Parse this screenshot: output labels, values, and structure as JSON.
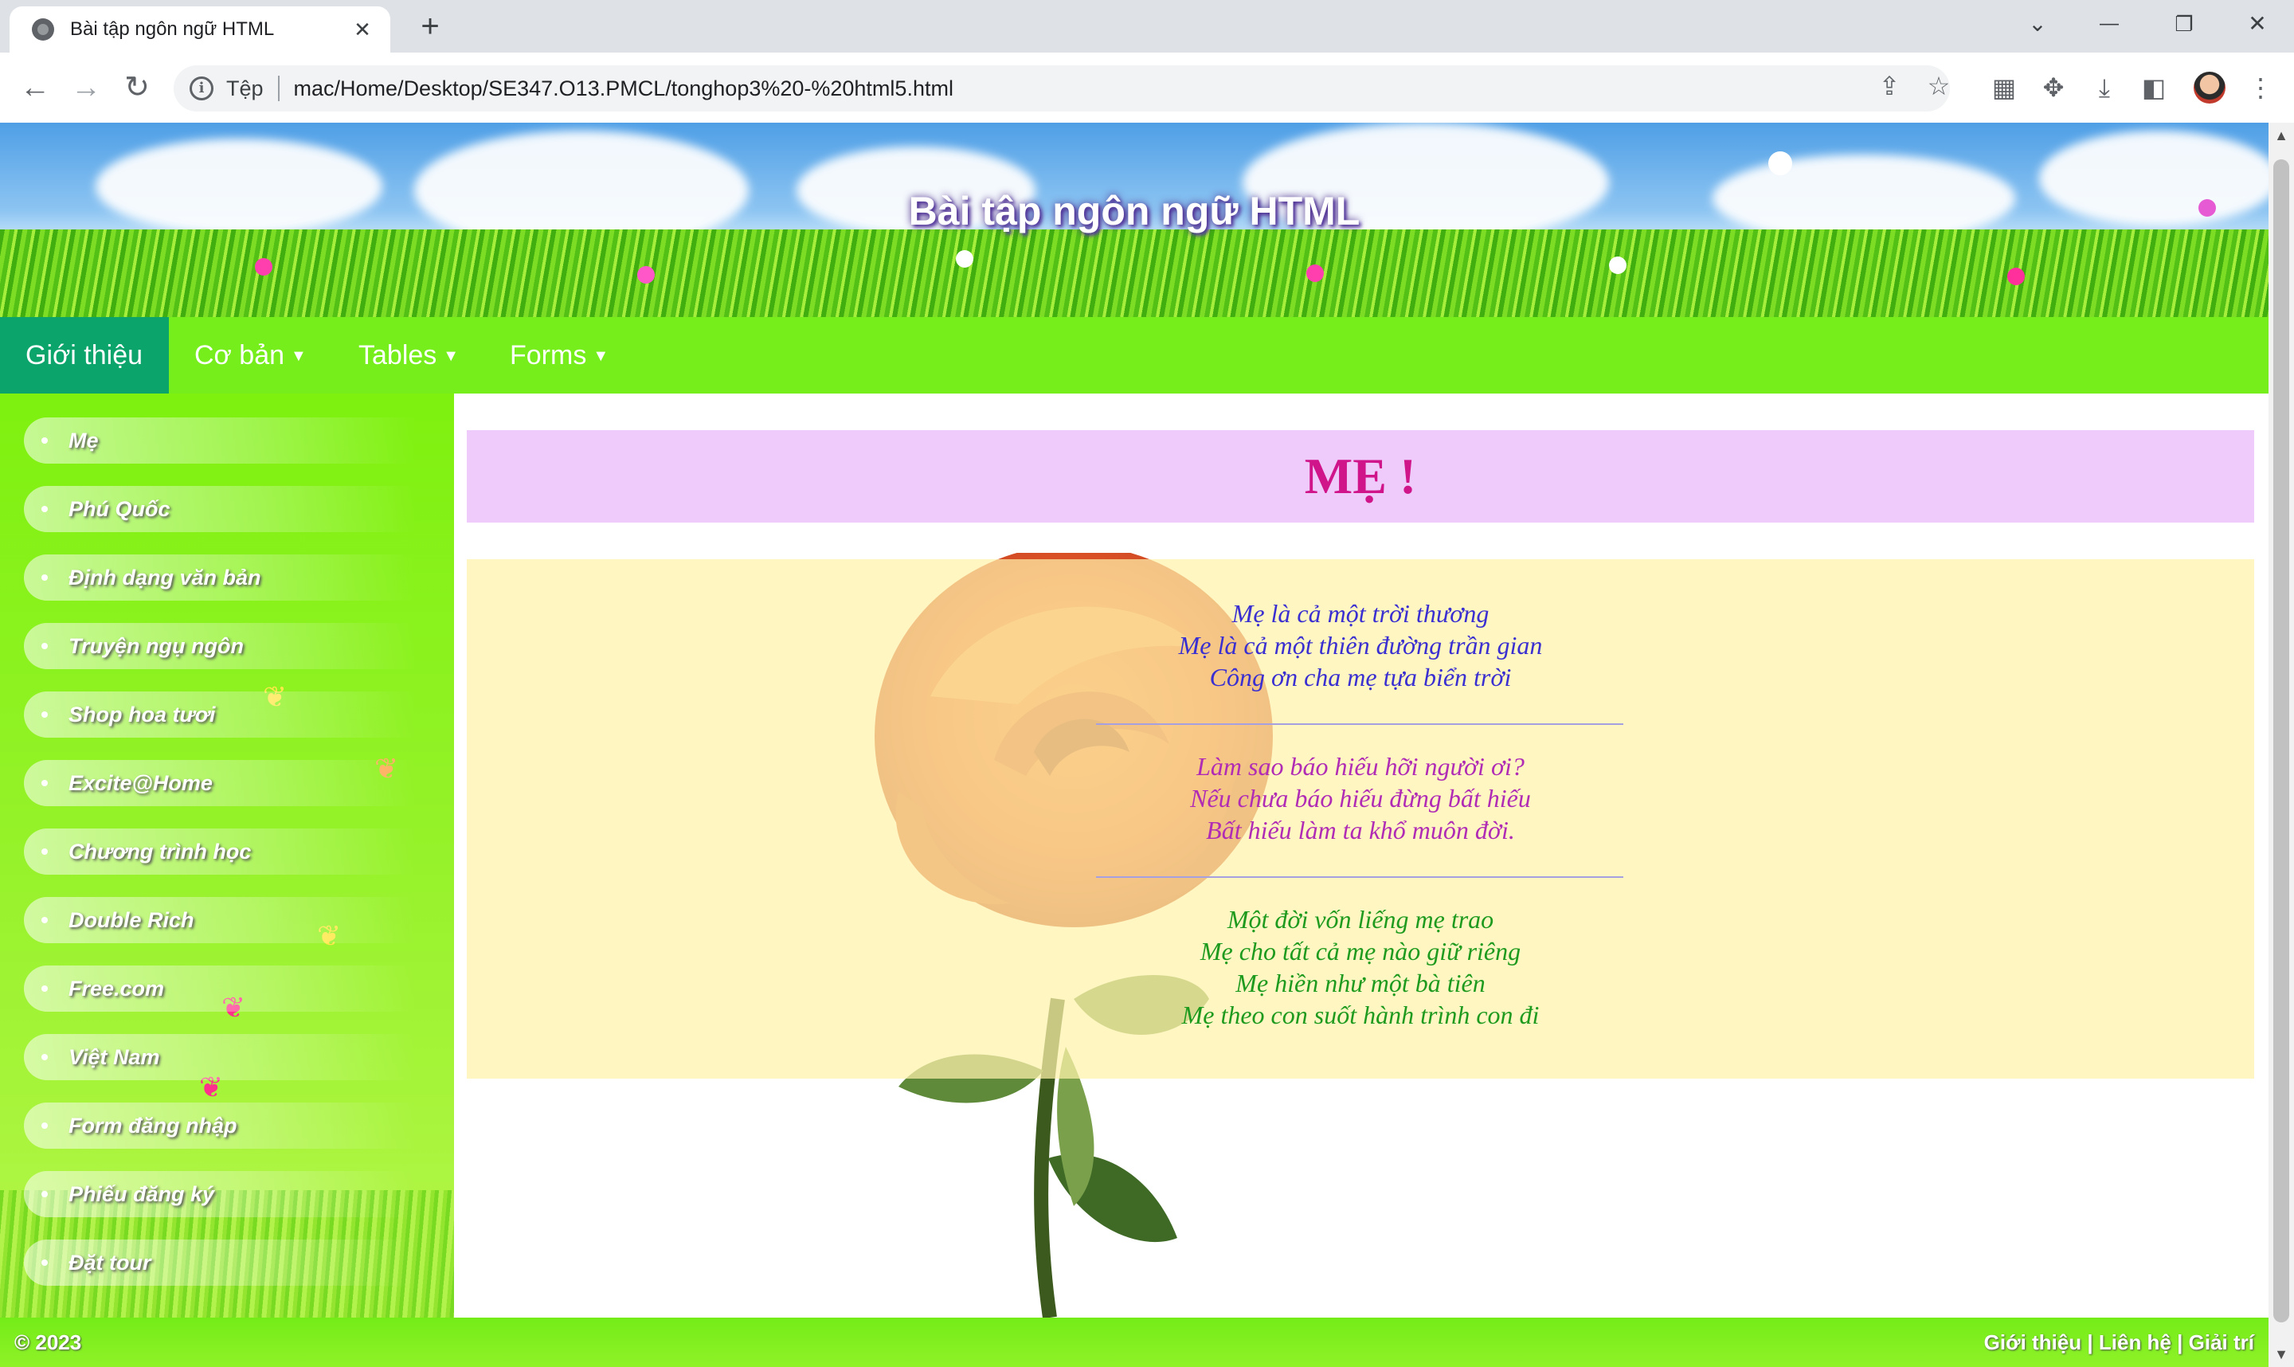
{
  "browser": {
    "tab_title": "Bài tập ngôn ngữ HTML",
    "tab_close": "✕",
    "new_tab": "+",
    "scheme_label": "Tệp",
    "url": "mac/Home/Desktop/SE347.O13.PMCL/tonghop3%20-%20html5.html",
    "window_controls": {
      "tab_search": "⌄",
      "minimize": "—",
      "restore": "❐",
      "close": "✕"
    },
    "nav": {
      "back": "←",
      "forward": "→",
      "reload": "↻"
    }
  },
  "banner": {
    "title": "Bài tập ngôn ngữ HTML"
  },
  "menu": {
    "items": [
      {
        "label": "Giới thiệu",
        "caret": ""
      },
      {
        "label": "Cơ bản",
        "caret": "▼"
      },
      {
        "label": "Tables",
        "caret": "▼"
      },
      {
        "label": "Forms",
        "caret": "▼"
      }
    ]
  },
  "sidebar": {
    "items": [
      "Mẹ",
      "Phú Quốc",
      "Định dạng văn bản",
      "Truyện ngụ ngôn",
      "Shop hoa tươi",
      "Excite@Home",
      "Chương trình học",
      "Double Rich",
      "Free.com",
      "Việt Nam",
      "Form đăng nhập",
      "Phiếu đăng ký",
      "Đặt tour"
    ]
  },
  "main": {
    "heading": "MẸ !",
    "stanzas": [
      {
        "color": "#3a2fd0",
        "lines": [
          "Mẹ là cả một trời thương",
          "Mẹ là cả một thiên đường trần gian",
          "Công ơn cha mẹ tựa biển trời"
        ]
      },
      {
        "color": "#b02cb5",
        "lines": [
          "Làm sao báo hiếu hỡi người ơi?",
          "Nếu chưa báo hiếu đừng bất hiếu",
          "Bất hiếu làm ta khổ muôn đời."
        ]
      },
      {
        "color": "#1e9a1e",
        "lines": [
          "Một đời vốn liếng mẹ trao",
          "Mẹ cho tất cả mẹ nào giữ riêng",
          "Mẹ hiền như một bà tiên",
          "Mẹ theo con suốt hành trình con đi"
        ]
      }
    ]
  },
  "footer": {
    "copyright": "© 2023",
    "links": [
      "Giới thiệu",
      "Liên hệ",
      "Giải trí"
    ],
    "separator": " | "
  },
  "colors": {
    "menu_bar": "#76ee1c",
    "menu_active": "#0ba46b",
    "heading_bg": "#eecbfa",
    "heading_text": "#d0158a",
    "poem_bg": "#fff2aa"
  }
}
